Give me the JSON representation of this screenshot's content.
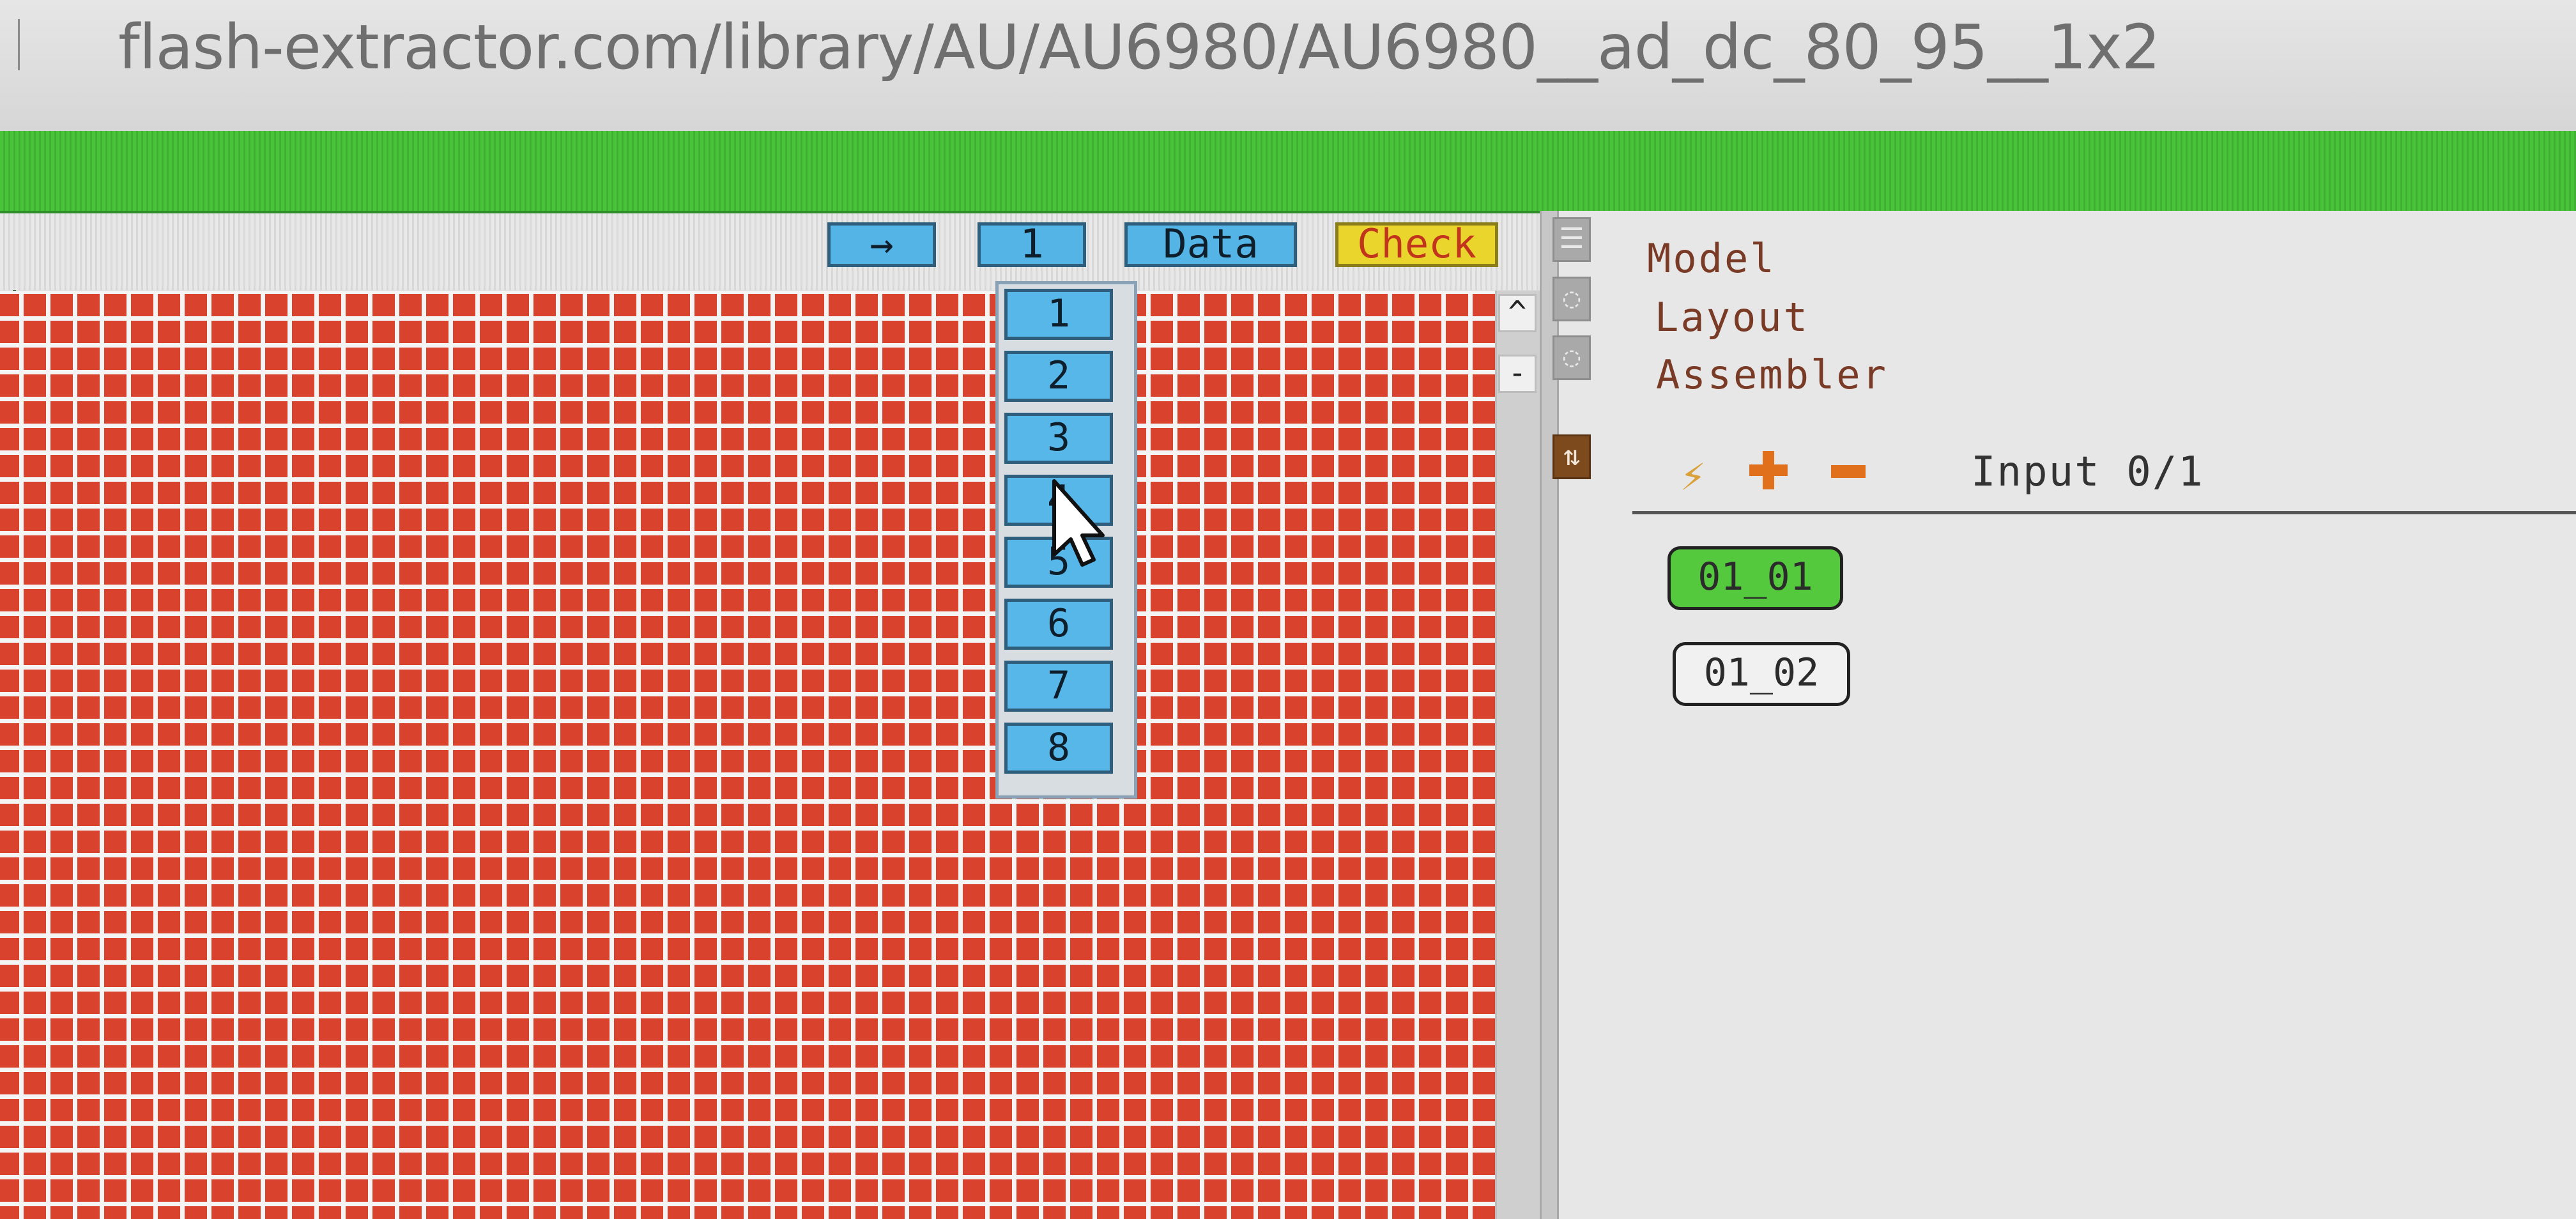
{
  "browser": {
    "url": "flash-extractor.com/library/AU/AU6980/AU6980__ad_dc_80_95__1x2"
  },
  "toolbar": {
    "arrow_label": "→",
    "page_label": "1",
    "data_label": "Data",
    "check_label": "Check"
  },
  "dropdown": {
    "items": [
      "1",
      "2",
      "3",
      "4",
      "5",
      "6",
      "7",
      "8"
    ]
  },
  "grid_scroll": {
    "up_label": "^",
    "minus_label": "-"
  },
  "side_menu": {
    "model": "Model",
    "layout": "Layout",
    "assembler": "Assembler"
  },
  "inputs": {
    "status": "Input 0/1",
    "chips": [
      "01_01",
      "01_02"
    ]
  },
  "colors": {
    "accent_green": "#49c43a",
    "grid_red": "#d9432e",
    "button_blue": "#54b4e6",
    "check_yellow": "#e9d52b",
    "chip_active": "#55c93d"
  }
}
